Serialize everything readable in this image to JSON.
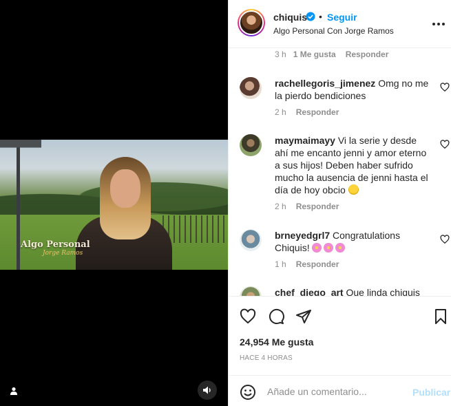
{
  "post": {
    "username": "chiquis",
    "separator": "•",
    "follow_label": "Seguir",
    "subtitle": "Algo Personal Con Jorge Ramos",
    "video_caption_line1": "Algo Personal",
    "video_caption_line2": "Jorge Ramos"
  },
  "top_meta": {
    "time": "3 h",
    "likes": "1 Me gusta",
    "reply": "Responder"
  },
  "comments": [
    {
      "username": "rachellegoris_jimenez",
      "text": "Omg no me la pierdo bendiciones",
      "time": "2 h",
      "reply": "Responder"
    },
    {
      "username": "maymaimayy",
      "text": "Vi la serie y desde ahí me encanto jenni y amor eterno a sus hijos! Deben haber sufrido mucho la ausencia de jenni hasta el día de hoy obcio",
      "time": "2 h",
      "reply": "Responder"
    },
    {
      "username": "brneyedgrl7",
      "text": "Congratulations Chiquis!",
      "time": "1 h",
      "reply": "Responder"
    },
    {
      "username": "chef_diego_art",
      "text": "Que linda chiquis"
    }
  ],
  "stats": {
    "likes": "24,954 Me gusta",
    "time_ago": "HACE 4 HORAS"
  },
  "composer": {
    "placeholder": "Añade un comentario...",
    "post_label": "Publicar"
  },
  "colors": {
    "accent": "#0095f6",
    "post_disabled": "#b2dffc",
    "muted": "#8e8e8e",
    "text": "#262626"
  },
  "icons": {
    "verified": "verified-badge-icon",
    "more": "more-options-icon",
    "heart": "heart-icon",
    "comment": "comment-icon",
    "share": "share-icon",
    "save": "bookmark-icon",
    "emoji": "emoji-icon",
    "user_tag": "user-tag-icon",
    "sound": "sound-icon"
  }
}
